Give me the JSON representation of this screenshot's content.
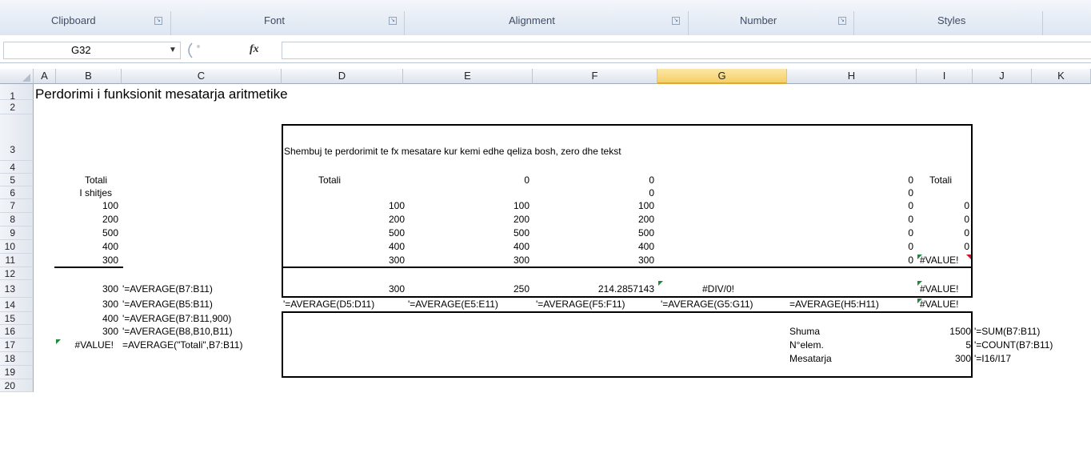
{
  "ribbon": {
    "groups": [
      "Clipboard",
      "Font",
      "Alignment",
      "Number",
      "Styles"
    ]
  },
  "formula_bar": {
    "name_box": "G32",
    "fx_label": "fx",
    "formula": ""
  },
  "columns": [
    "A",
    "B",
    "C",
    "D",
    "E",
    "F",
    "G",
    "H",
    "I",
    "J",
    "K"
  ],
  "selected_column": "G",
  "rows": [
    "1",
    "2",
    "3",
    "4",
    "5",
    "6",
    "7",
    "8",
    "9",
    "10",
    "11",
    "12",
    "13",
    "14",
    "15",
    "16",
    "17",
    "18",
    "19",
    "20"
  ],
  "cells": {
    "title": "Perdorimi i funksionit mesatarja aritmetike",
    "d3": "Shembuj te perdorimit te fx mesatare kur kemi edhe qeliza bosh, zero dhe tekst",
    "b5": "Totali",
    "b6": "I shitjes",
    "b7": "100",
    "b8": "200",
    "b9": "500",
    "b10": "400",
    "b11": "300",
    "b13": "300",
    "c13": "'=AVERAGE(B7:B11)",
    "b14": "300",
    "c14": "'=AVERAGE(B5:B11)",
    "b15": "400",
    "c15": "'=AVERAGE(B7:B11,900)",
    "b16": "300",
    "c16": "'=AVERAGE(B8,B10,B11)",
    "b17": "#VALUE!",
    "c17": "=AVERAGE(\"Totali\",B7:B11)",
    "d5": "Totali",
    "d7": "100",
    "d8": "200",
    "d9": "500",
    "d10": "400",
    "d11": "300",
    "d13": "300",
    "d14": "'=AVERAGE(D5:D11)",
    "e5": "0",
    "e7": "100",
    "e8": "200",
    "e9": "500",
    "e10": "400",
    "e11": "300",
    "e13": "250",
    "e14": "'=AVERAGE(E5:E11)",
    "f5": "0",
    "f6": "0",
    "f7": "100",
    "f8": "200",
    "f9": "500",
    "f10": "400",
    "f11": "300",
    "f13": "214.2857143",
    "f14": "'=AVERAGE(F5:F11)",
    "g13": "#DIV/0!",
    "g14": "'=AVERAGE(G5:G11)",
    "h5": "0",
    "h6": "0",
    "h7": "0",
    "h8": "0",
    "h9": "0",
    "h10": "0",
    "h11": "0",
    "h14": "=AVERAGE(H5:H11)",
    "h16": "Shuma",
    "h17": "N°elem.",
    "h18": "Mesatarja",
    "i5": "Totali",
    "i7": "0",
    "i8": "0",
    "i9": "0",
    "i10": "0",
    "i11": "#VALUE!",
    "i13": "#VALUE!",
    "i14": "#VALUE!",
    "i16": "1500",
    "i17": "5",
    "i18": "300",
    "j16": "'=SUM(B7:B11)",
    "j17": "'=COUNT(B7:B11)",
    "j18": "'=I16/I17"
  }
}
